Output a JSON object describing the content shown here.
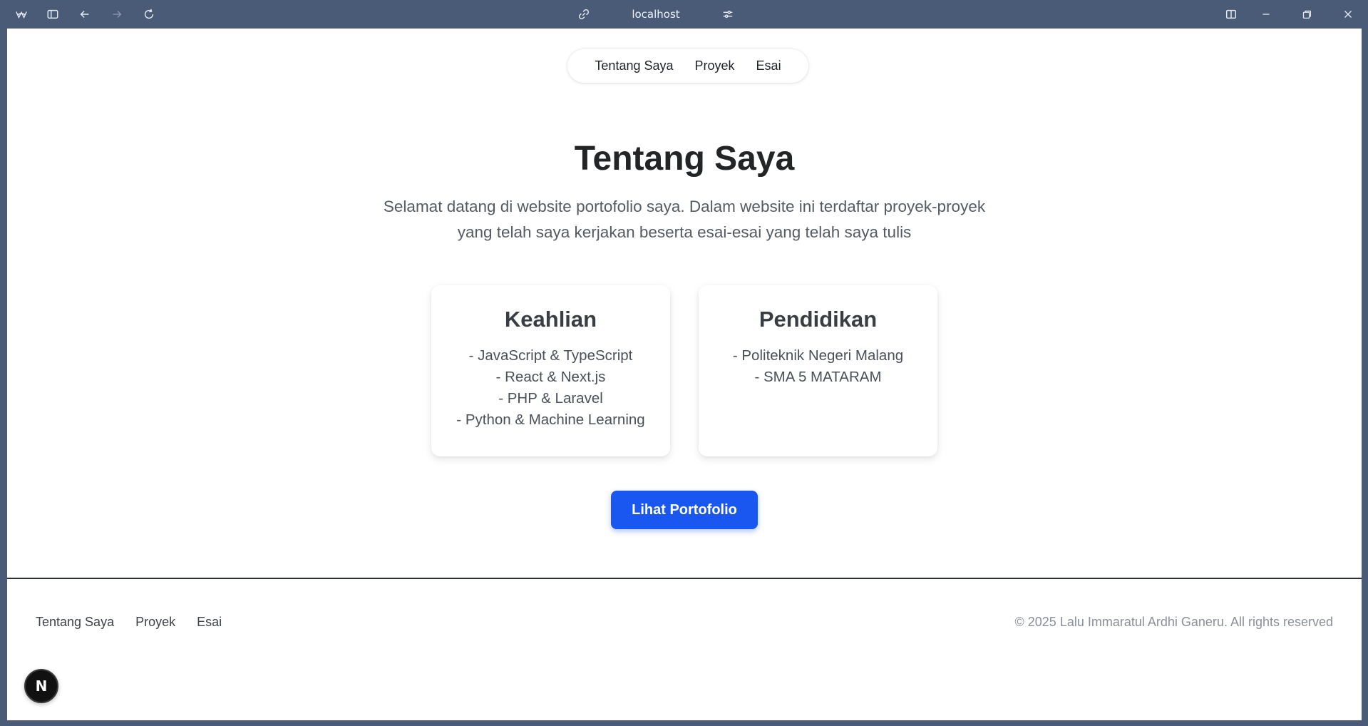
{
  "browser": {
    "url": "localhost",
    "icons": {
      "app": "browser-logo-icon",
      "sidebar": "sidebar-toggle-icon",
      "back": "back-arrow-icon",
      "forward": "forward-arrow-icon",
      "reload": "reload-icon",
      "link": "link-icon",
      "settings": "site-settings-icon",
      "split": "split-view-icon",
      "minimize": "minimize-icon",
      "restore": "restore-icon",
      "close": "close-icon"
    }
  },
  "nav": {
    "items": [
      {
        "label": "Tentang Saya"
      },
      {
        "label": "Proyek"
      },
      {
        "label": "Esai"
      }
    ]
  },
  "hero": {
    "title": "Tentang Saya",
    "subtitle": "Selamat datang di website portofolio saya. Dalam website ini terdaftar proyek-proyek yang telah saya kerjakan beserta esai-esai yang telah saya tulis"
  },
  "cards": [
    {
      "title": "Keahlian",
      "items": [
        "- JavaScript & TypeScript",
        "- React & Next.js",
        "- PHP & Laravel",
        "- Python & Machine Learning"
      ]
    },
    {
      "title": "Pendidikan",
      "items": [
        "- Politeknik Negeri Malang",
        "- SMA 5 MATARAM"
      ]
    }
  ],
  "cta": {
    "label": "Lihat Portofolio",
    "color": "#1a56f0"
  },
  "footer": {
    "links": [
      {
        "label": "Tentang Saya"
      },
      {
        "label": "Proyek"
      },
      {
        "label": "Esai"
      }
    ],
    "copyright": "© 2025 Lalu Immaratul Ardhi Ganeru. All rights reserved"
  },
  "dev_badge": {
    "label": "N",
    "icon": "nextjs-logo-icon"
  }
}
